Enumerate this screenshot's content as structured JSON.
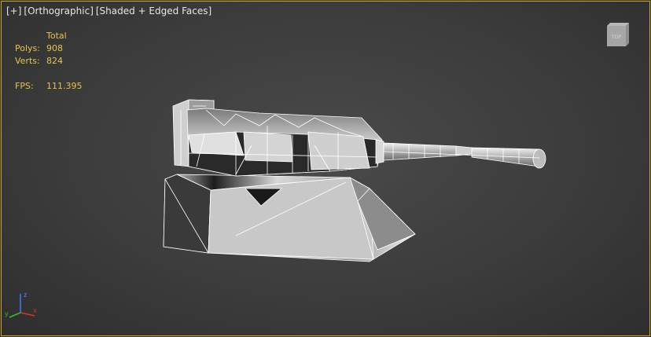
{
  "viewport": {
    "label_plus": "[+]",
    "label_view": "[Orthographic]",
    "label_shading": "[Shaded + Edged Faces]",
    "active_border_color": "#c9a800"
  },
  "stats": {
    "header": "Total",
    "polys_label": "Polys:",
    "polys_value": "908",
    "verts_label": "Verts:",
    "verts_value": "824",
    "fps_label": "FPS:",
    "fps_value": "111.395",
    "text_color": "#e4c44a"
  },
  "viewcube": {
    "icon": "viewcube-icon",
    "face_label": "TOP"
  },
  "axis_gizmo": {
    "icon": "axis-tripod-icon",
    "x_label": "x",
    "y_label": "y",
    "z_label": "z"
  },
  "model": {
    "icon": "gun-turret-model"
  }
}
